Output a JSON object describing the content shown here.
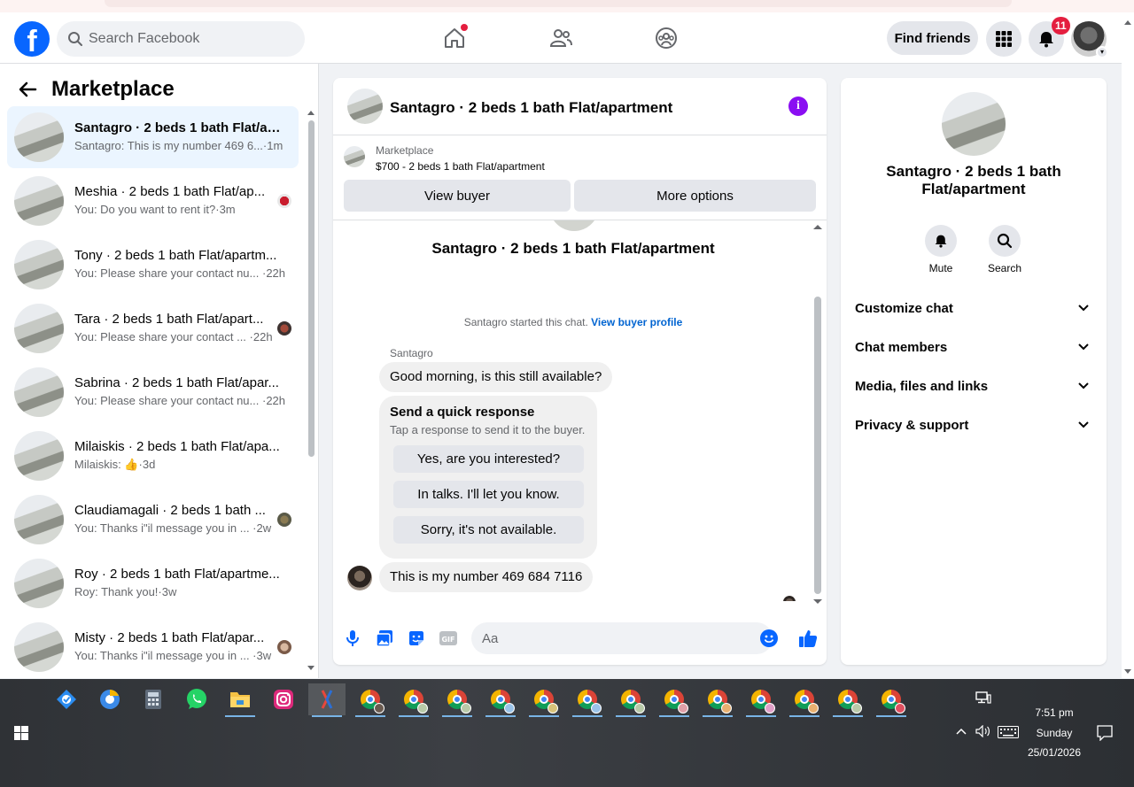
{
  "topbar": {
    "search_placeholder": "Search Facebook",
    "find_friends": "Find friends",
    "notifications_count": "11"
  },
  "left": {
    "title": "Marketplace",
    "conversations": [
      {
        "name": "Santagro · 2 beds 1 bath Flat/ap...",
        "preview": "Santagro: This is my number 469 6...",
        "time": "·1m",
        "active": true
      },
      {
        "name": "Meshia · 2 beds 1 bath Flat/ap...",
        "preview": "You: Do you want to rent it?",
        "time": "·3m"
      },
      {
        "name": "Tony · 2 beds 1 bath Flat/apartm...",
        "preview": "You: Please share your contact nu...",
        "time": " ·22h"
      },
      {
        "name": "Tara · 2 beds 1 bath Flat/apart...",
        "preview": "You: Please share your contact ...",
        "time": " ·22h"
      },
      {
        "name": "Sabrina · 2 beds 1 bath Flat/apar...",
        "preview": "You: Please share your contact nu...",
        "time": " ·22h"
      },
      {
        "name": "Milaiskis · 2 beds 1 bath Flat/apa...",
        "preview": "Milaiskis: 👍",
        "time": "·3d"
      },
      {
        "name": "Claudiamagali · 2 beds 1 bath ...",
        "preview": "You: Thanks i\"il message you in ...",
        "time": " ·2w"
      },
      {
        "name": "Roy · 2 beds 1 bath Flat/apartme...",
        "preview": "Roy: Thank you!",
        "time": "·3w"
      },
      {
        "name": "Misty · 2 beds 1 bath Flat/apar...",
        "preview": "You: Thanks i\"il message you in ...",
        "time": " ·3w"
      }
    ]
  },
  "chat": {
    "title": "Santagro · 2 beds 1 bath Flat/apartment",
    "marketplace_label": "Marketplace",
    "listing": "$700 - 2 beds 1 bath Flat/apartment",
    "view_buyer": "View buyer",
    "more_options": "More options",
    "big_title": "Santagro · 2 beds 1 bath Flat/apartment",
    "started_text": "Santagro started this chat.",
    "view_buyer_profile": "View buyer profile",
    "sender_name": "Santagro",
    "msg1": "Good morning, is this still available?",
    "quick_title": "Send a quick response",
    "quick_sub": "Tap a response to send it to the buyer.",
    "quick_responses": [
      "Yes, are you interested?",
      "In talks. I'll let you know.",
      "Sorry, it's not available."
    ],
    "msg2": "This is my number 469 684 7116",
    "composer_placeholder": "Aa"
  },
  "right": {
    "name": "Santagro · 2 beds 1 bath Flat/apartment",
    "mute": "Mute",
    "search": "Search",
    "sections": [
      "Customize chat",
      "Chat members",
      "Media, files and links",
      "Privacy & support"
    ]
  },
  "taskbar": {
    "time": "7:51 pm",
    "day": "Sunday",
    "date": "25/01/2026"
  },
  "colors": {
    "brand": "#0866ff",
    "badge": "#e41e3f",
    "info": "#8a0ef2",
    "active_conv": "#ebf5ff"
  }
}
